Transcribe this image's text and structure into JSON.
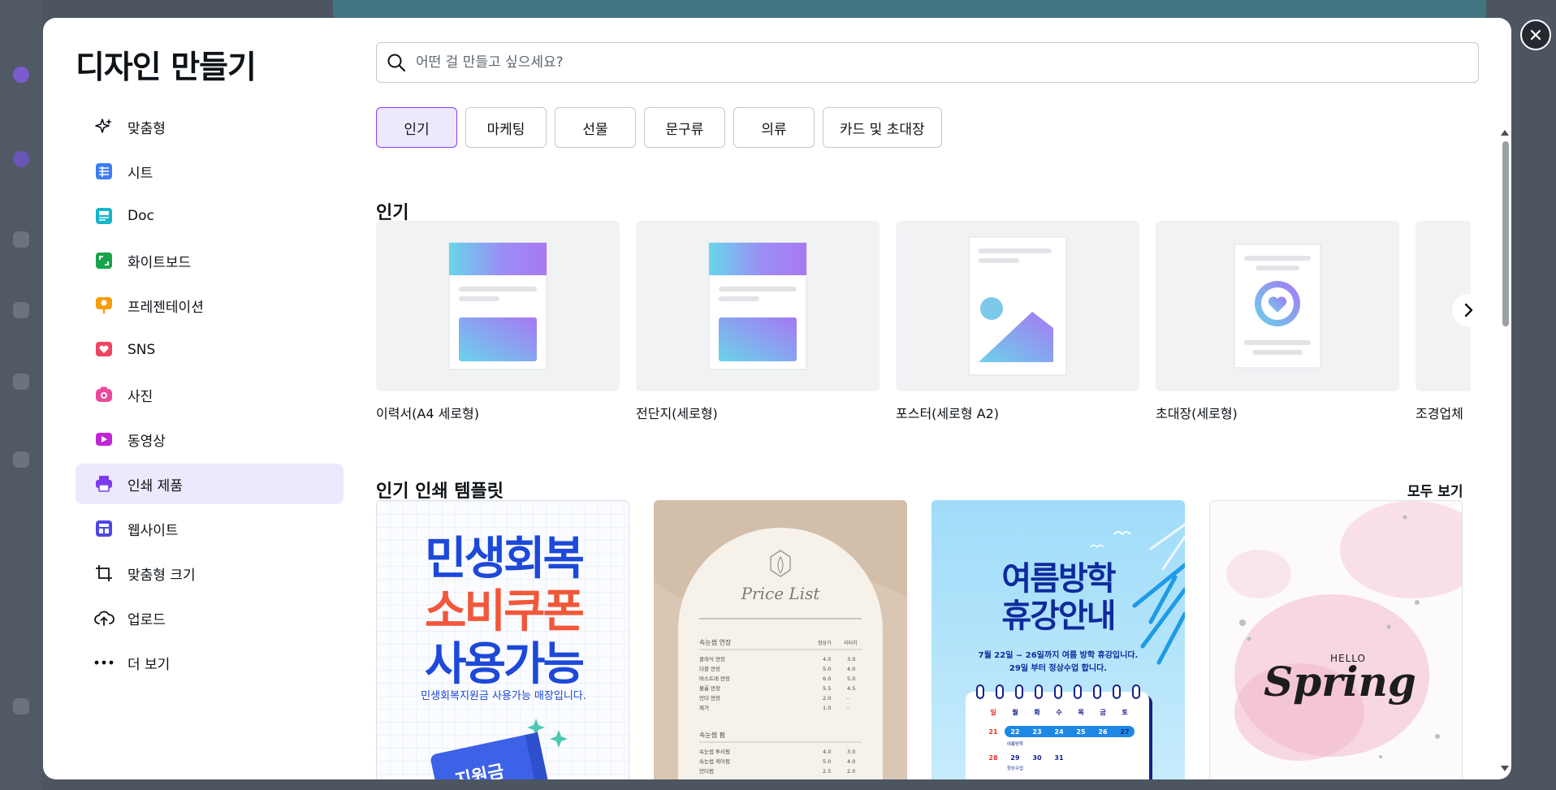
{
  "modal": {
    "title": "디자인 만들기"
  },
  "sidebar": {
    "items": [
      {
        "label": "맞춤형",
        "icon": "sparkle-icon"
      },
      {
        "label": "시트",
        "icon": "sheet-icon"
      },
      {
        "label": "Doc",
        "icon": "doc-icon"
      },
      {
        "label": "화이트보드",
        "icon": "whiteboard-icon"
      },
      {
        "label": "프레젠테이션",
        "icon": "presentation-icon"
      },
      {
        "label": "SNS",
        "icon": "heart-icon"
      },
      {
        "label": "사진",
        "icon": "camera-icon"
      },
      {
        "label": "동영상",
        "icon": "video-icon"
      },
      {
        "label": "인쇄 제품",
        "icon": "printer-icon",
        "active": true
      },
      {
        "label": "웹사이트",
        "icon": "website-icon"
      },
      {
        "label": "맞춤형 크기",
        "icon": "custom-size-icon"
      },
      {
        "label": "업로드",
        "icon": "cloud-upload-icon"
      },
      {
        "label": "더 보기",
        "icon": "more-icon"
      }
    ]
  },
  "search": {
    "placeholder": "어떤 걸 만들고 싶으세요?"
  },
  "tabs": [
    {
      "label": "인기",
      "active": true
    },
    {
      "label": "마케팅"
    },
    {
      "label": "선물"
    },
    {
      "label": "문구류"
    },
    {
      "label": "의류"
    },
    {
      "label": "카드 및 초대장"
    }
  ],
  "popular": {
    "heading": "인기",
    "cards": [
      {
        "label": "이력서(A4 세로형)"
      },
      {
        "label": "전단지(세로형)"
      },
      {
        "label": "포스터(세로형 A2)"
      },
      {
        "label": "초대장(세로형)"
      },
      {
        "label": "조경업체"
      }
    ]
  },
  "templates": {
    "heading": "인기 인쇄 템플릿",
    "see_all": "모두 보기",
    "items": [
      {
        "line1": "민생회복",
        "line2": "소비쿠폰",
        "line3": "사용가능",
        "sub": "민생회복지원금 사용가능 매장입니다.",
        "ticket": "지원금"
      },
      {
        "script": "Price List",
        "section1": "속눈썹 연장",
        "col1": "정상가",
        "col2": "리터치",
        "rows": [
          {
            "name": "클래식 연장",
            "a": "4.0",
            "b": "3.0"
          },
          {
            "name": "더블 연장",
            "a": "5.0",
            "b": "4.0"
          },
          {
            "name": "버스트래 연장",
            "a": "6.0",
            "b": "5.0"
          },
          {
            "name": "볼륨 연장",
            "a": "5.5",
            "b": "4.5"
          },
          {
            "name": "언더 연장",
            "a": "2.0",
            "b": "-"
          },
          {
            "name": "제거",
            "a": "1.0",
            "b": "-"
          }
        ],
        "section2": "속눈썹 펌",
        "rows2": [
          {
            "name": "속눈썹 투리펌",
            "a": "4.0",
            "b": "3.0"
          },
          {
            "name": "속눈썹 케어펌",
            "a": "5.0",
            "b": "4.0"
          },
          {
            "name": "언더펌",
            "a": "2.5",
            "b": "2.0"
          }
        ]
      },
      {
        "line1": "여름방학",
        "line2": "휴강안내",
        "notice1": "7월 22일 ~ 26일까지 여름 방학 휴강입니다.",
        "notice2": "29일 부터 정상수업 합니다.",
        "weekdays": [
          "일",
          "월",
          "화",
          "수",
          "목",
          "금",
          "토"
        ],
        "week1": [
          "21",
          "22",
          "23",
          "24",
          "25",
          "26",
          "27"
        ],
        "vacation": "여름방학",
        "week2": [
          "28",
          "29",
          "30",
          "31"
        ],
        "regular": "정상수업"
      },
      {
        "hello": "HELLO",
        "script": "Spring"
      }
    ]
  }
}
